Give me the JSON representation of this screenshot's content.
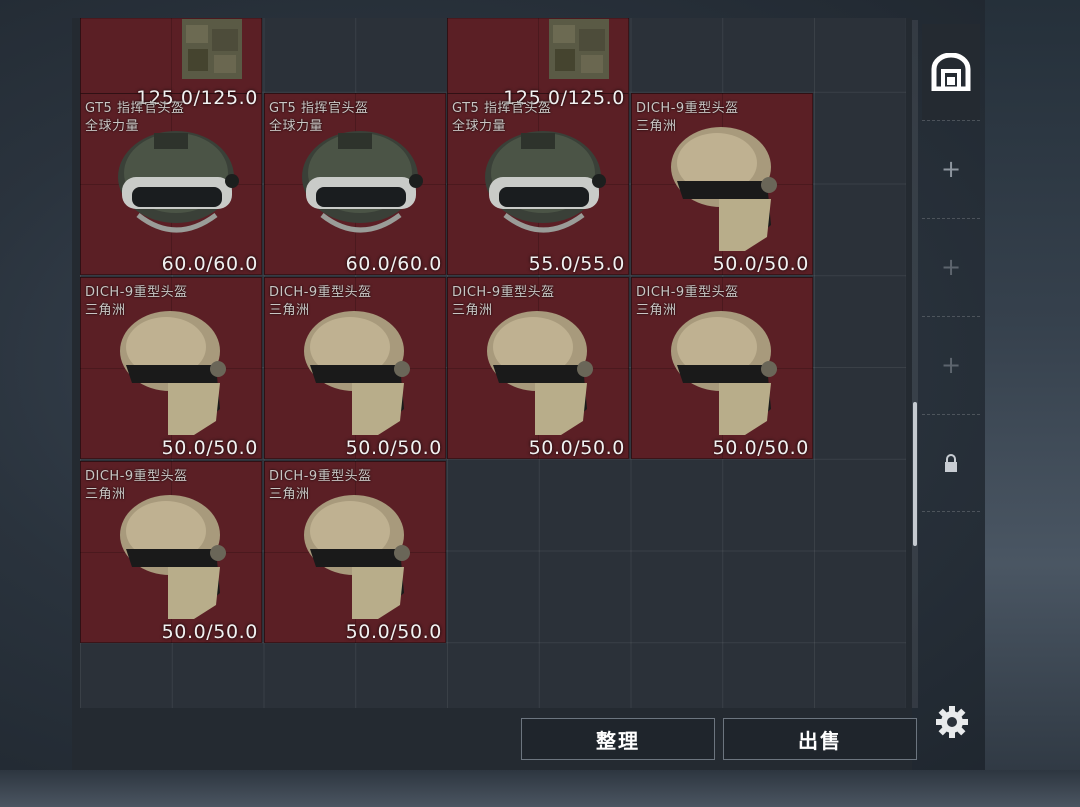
{
  "inventory": {
    "top_row": [
      {
        "durability": "125.0/125.0"
      },
      {
        "durability": "125.0/125.0"
      }
    ],
    "items": [
      {
        "name": "GT5 指挥官头盔",
        "sub": "全球力量",
        "durability": "60.0/60.0",
        "icon": "gt5-helmet-icon"
      },
      {
        "name": "GT5 指挥官头盔",
        "sub": "全球力量",
        "durability": "60.0/60.0",
        "icon": "gt5-helmet-icon"
      },
      {
        "name": "GT5 指挥官头盔",
        "sub": "全球力量",
        "durability": "55.0/55.0",
        "icon": "gt5-helmet-icon"
      },
      {
        "name": "DICH-9重型头盔",
        "sub": "三角洲",
        "durability": "50.0/50.0",
        "icon": "dich9-helmet-icon"
      },
      {
        "name": "DICH-9重型头盔",
        "sub": "三角洲",
        "durability": "50.0/50.0",
        "icon": "dich9-helmet-icon"
      },
      {
        "name": "DICH-9重型头盔",
        "sub": "三角洲",
        "durability": "50.0/50.0",
        "icon": "dich9-helmet-icon"
      },
      {
        "name": "DICH-9重型头盔",
        "sub": "三角洲",
        "durability": "50.0/50.0",
        "icon": "dich9-helmet-icon"
      },
      {
        "name": "DICH-9重型头盔",
        "sub": "三角洲",
        "durability": "50.0/50.0",
        "icon": "dich9-helmet-icon"
      },
      {
        "name": "DICH-9重型头盔",
        "sub": "三角洲",
        "durability": "50.0/50.0",
        "icon": "dich9-helmet-icon"
      },
      {
        "name": "DICH-9重型头盔",
        "sub": "三角洲",
        "durability": "50.0/50.0",
        "icon": "dich9-helmet-icon"
      }
    ]
  },
  "sidebar": {
    "slots": [
      {
        "icon": "backpack-icon",
        "active": true
      },
      {
        "icon": "plus-icon"
      },
      {
        "icon": "plus-icon"
      },
      {
        "icon": "plus-icon"
      },
      {
        "icon": "lock-icon"
      }
    ]
  },
  "actions": {
    "organize_label": "整理",
    "sell_label": "出售"
  },
  "colors": {
    "item_bg": "#5b1f25",
    "panel_bg": "#242a31"
  }
}
